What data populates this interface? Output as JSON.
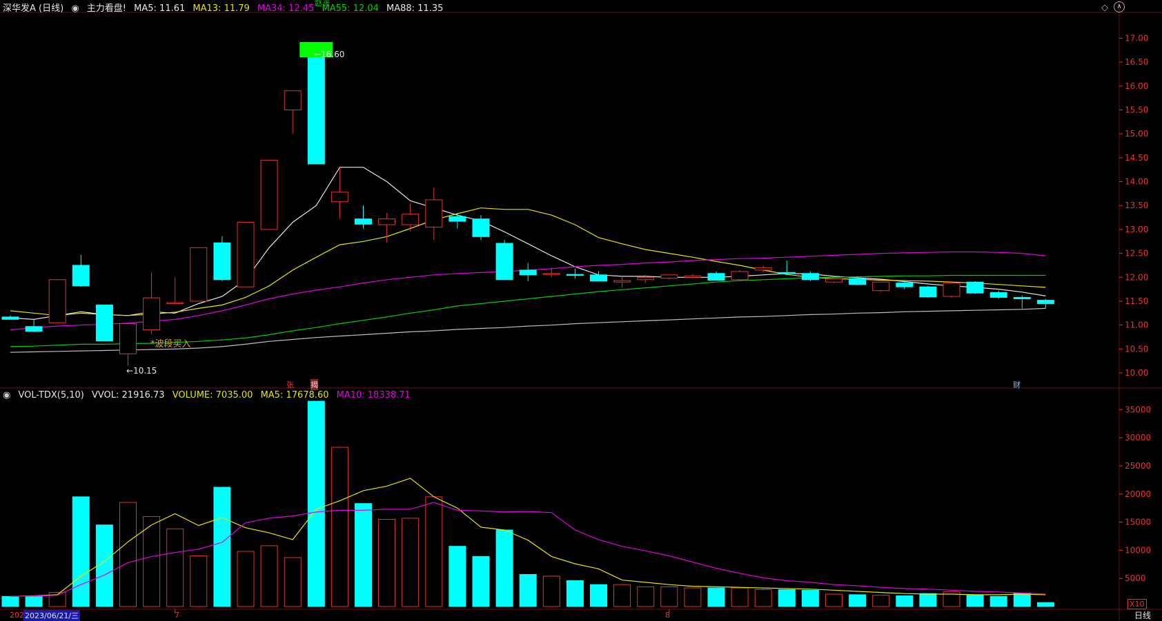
{
  "colors": {
    "up": "#e8322f",
    "down": "#00ffff",
    "ma5": "#e6e6e6",
    "ma13": "#e6e600",
    "ma34": "#e600e6",
    "ma55": "#00d200",
    "ma88": "#bfbfbf",
    "grid": "#7a0d0d",
    "axis": "#e8322f",
    "vol_ma5": "#e6e600",
    "vol_ma10": "#e600e6"
  },
  "header": {
    "title": "深华发A (日线)",
    "indicator_name": "主力看盘!",
    "ma5": "MA5: 11.61",
    "ma13": "MA13: 11.79",
    "ma34": "MA34: 12.45",
    "ma55": "MA55: 12.04",
    "ma88": "MA88: 11.35"
  },
  "vol_header": {
    "name": "VOL-TDX(5,10)",
    "vvol": "VVOL: 21916.73",
    "volume": "VOLUME: 7035.00",
    "ma5": "MA5: 17678.60",
    "ma10": "MA10: 18338.71"
  },
  "annotations": {
    "high_label": "16.60",
    "low_label": "10.15",
    "buy_signal": "*波段买入",
    "top_tag": "赵涨",
    "tag_zhang": "张",
    "tag_jie": "揭",
    "tag_cai": "财",
    "multiplier": "X10",
    "period": "日线"
  },
  "date_axis": {
    "year_fragment": "202",
    "cursor_date": "2023/06/21/三",
    "month_7": "7",
    "month_8": "8"
  },
  "chart_data": [
    {
      "type": "candlestick",
      "title": "深华发A (日线)",
      "ylim": [
        9.9,
        17.15
      ],
      "y_ticks": [
        "17.00",
        "16.50",
        "16.00",
        "15.50",
        "15.00",
        "14.50",
        "14.00",
        "13.50",
        "13.00",
        "12.50",
        "12.00",
        "11.50",
        "11.00",
        "10.50",
        "10.00"
      ],
      "candles": [
        {
          "o": 11.17,
          "h": 11.2,
          "l": 11.12,
          "c": 11.12
        },
        {
          "o": 10.97,
          "h": 11.11,
          "l": 10.85,
          "c": 10.87
        },
        {
          "o": 11.05,
          "h": 11.95,
          "l": 11.03,
          "c": 11.95
        },
        {
          "o": 12.25,
          "h": 12.47,
          "l": 11.8,
          "c": 11.82
        },
        {
          "o": 11.42,
          "h": 11.42,
          "l": 10.67,
          "c": 10.67
        },
        {
          "o": 10.4,
          "h": 11.03,
          "l": 10.15,
          "c": 11.03
        },
        {
          "o": 10.9,
          "h": 12.1,
          "l": 10.8,
          "c": 11.57
        },
        {
          "o": 11.47,
          "h": 12.0,
          "l": 11.47,
          "c": 11.47
        },
        {
          "o": 11.5,
          "h": 12.62,
          "l": 11.5,
          "c": 12.62
        },
        {
          "o": 12.72,
          "h": 12.86,
          "l": 11.92,
          "c": 11.95
        },
        {
          "o": 11.8,
          "h": 13.15,
          "l": 11.8,
          "c": 13.15
        },
        {
          "o": 13.0,
          "h": 14.45,
          "l": 13.0,
          "c": 14.45
        },
        {
          "o": 15.5,
          "h": 15.9,
          "l": 15.0,
          "c": 15.9
        },
        {
          "o": 16.6,
          "h": 16.92,
          "l": 14.37,
          "c": 14.37
        },
        {
          "o": 13.58,
          "h": 14.3,
          "l": 13.23,
          "c": 13.78
        },
        {
          "o": 13.22,
          "h": 13.5,
          "l": 13.02,
          "c": 13.11
        },
        {
          "o": 13.1,
          "h": 13.35,
          "l": 12.73,
          "c": 13.22
        },
        {
          "o": 13.1,
          "h": 13.55,
          "l": 12.95,
          "c": 13.32
        },
        {
          "o": 13.05,
          "h": 13.88,
          "l": 12.78,
          "c": 13.62
        },
        {
          "o": 13.27,
          "h": 13.35,
          "l": 13.02,
          "c": 13.17
        },
        {
          "o": 13.22,
          "h": 13.3,
          "l": 12.78,
          "c": 12.85
        },
        {
          "o": 12.71,
          "h": 12.78,
          "l": 11.95,
          "c": 11.95
        },
        {
          "o": 12.15,
          "h": 12.3,
          "l": 11.92,
          "c": 12.05
        },
        {
          "o": 12.06,
          "h": 12.2,
          "l": 12.0,
          "c": 12.08
        },
        {
          "o": 12.06,
          "h": 12.18,
          "l": 11.97,
          "c": 12.04
        },
        {
          "o": 12.05,
          "h": 12.13,
          "l": 11.92,
          "c": 11.92
        },
        {
          "o": 11.9,
          "h": 12.0,
          "l": 11.78,
          "c": 11.93
        },
        {
          "o": 11.95,
          "h": 12.05,
          "l": 11.88,
          "c": 12.0
        },
        {
          "o": 11.98,
          "h": 12.05,
          "l": 11.95,
          "c": 12.05
        },
        {
          "o": 12.0,
          "h": 12.07,
          "l": 11.98,
          "c": 12.03
        },
        {
          "o": 12.08,
          "h": 12.12,
          "l": 11.93,
          "c": 11.94
        },
        {
          "o": 11.95,
          "h": 12.15,
          "l": 11.93,
          "c": 12.12
        },
        {
          "o": 12.15,
          "h": 12.25,
          "l": 12.1,
          "c": 12.2
        },
        {
          "o": 12.1,
          "h": 12.35,
          "l": 12.05,
          "c": 12.08
        },
        {
          "o": 12.08,
          "h": 12.12,
          "l": 11.92,
          "c": 11.95
        },
        {
          "o": 11.9,
          "h": 11.98,
          "l": 11.88,
          "c": 11.97
        },
        {
          "o": 11.97,
          "h": 12.02,
          "l": 11.83,
          "c": 11.85
        },
        {
          "o": 11.72,
          "h": 11.9,
          "l": 11.7,
          "c": 11.9
        },
        {
          "o": 11.88,
          "h": 11.92,
          "l": 11.75,
          "c": 11.8
        },
        {
          "o": 11.8,
          "h": 11.82,
          "l": 11.57,
          "c": 11.59
        },
        {
          "o": 11.6,
          "h": 11.92,
          "l": 11.57,
          "c": 11.88
        },
        {
          "o": 11.9,
          "h": 11.92,
          "l": 11.65,
          "c": 11.67
        },
        {
          "o": 11.68,
          "h": 11.72,
          "l": 11.55,
          "c": 11.58
        },
        {
          "o": 11.58,
          "h": 11.62,
          "l": 11.35,
          "c": 11.55
        },
        {
          "o": 11.52,
          "h": 11.55,
          "l": 11.35,
          "c": 11.45
        }
      ],
      "ma_lines": [
        {
          "name": "MA5",
          "values": [
            11.15,
            11.12,
            11.2,
            11.28,
            11.22,
            11.2,
            11.28,
            11.25,
            11.45,
            11.6,
            11.95,
            12.62,
            13.15,
            13.5,
            14.3,
            14.3,
            14.0,
            13.6,
            13.45,
            13.3,
            13.18,
            12.95,
            12.7,
            12.45,
            12.22,
            12.05,
            12.02,
            12.02,
            12.0,
            12.0,
            12.0,
            12.02,
            12.05,
            12.08,
            12.07,
            12.02,
            11.99,
            11.96,
            11.91,
            11.86,
            11.82,
            11.79,
            11.75,
            11.69,
            11.61
          ]
        },
        {
          "name": "MA13",
          "values": [
            11.3,
            11.25,
            11.2,
            11.25,
            11.22,
            11.2,
            11.23,
            11.27,
            11.35,
            11.42,
            11.58,
            11.82,
            12.15,
            12.42,
            12.68,
            12.75,
            12.85,
            13.02,
            13.2,
            13.33,
            13.45,
            13.42,
            13.42,
            13.3,
            13.1,
            12.83,
            12.7,
            12.58,
            12.5,
            12.42,
            12.33,
            12.25,
            12.15,
            12.06,
            12.0,
            11.97,
            11.96,
            11.94,
            11.93,
            11.92,
            11.9,
            11.88,
            11.85,
            11.82,
            11.79
          ]
        },
        {
          "name": "MA34",
          "values": [
            10.9,
            10.95,
            10.98,
            11.0,
            11.02,
            11.04,
            11.08,
            11.12,
            11.2,
            11.3,
            11.42,
            11.55,
            11.65,
            11.73,
            11.8,
            11.88,
            11.95,
            12.0,
            12.05,
            12.08,
            12.1,
            12.12,
            12.15,
            12.18,
            12.22,
            12.25,
            12.27,
            12.3,
            12.32,
            12.35,
            12.37,
            12.39,
            12.4,
            12.42,
            12.44,
            12.46,
            12.48,
            12.5,
            12.51,
            12.52,
            12.53,
            12.53,
            12.52,
            12.5,
            12.45
          ]
        },
        {
          "name": "MA55",
          "values": [
            10.55,
            10.56,
            10.58,
            10.6,
            10.6,
            10.61,
            10.62,
            10.64,
            10.66,
            10.69,
            10.73,
            10.8,
            10.88,
            10.95,
            11.03,
            11.1,
            11.17,
            11.25,
            11.32,
            11.4,
            11.45,
            11.5,
            11.55,
            11.6,
            11.65,
            11.7,
            11.74,
            11.78,
            11.82,
            11.86,
            11.9,
            11.93,
            11.95,
            11.97,
            11.99,
            12.0,
            12.01,
            12.02,
            12.03,
            12.03,
            12.04,
            12.04,
            12.04,
            12.04,
            12.04
          ]
        },
        {
          "name": "MA88",
          "values": [
            10.43,
            10.44,
            10.45,
            10.46,
            10.47,
            10.48,
            10.49,
            10.5,
            10.52,
            10.55,
            10.6,
            10.66,
            10.7,
            10.74,
            10.77,
            10.8,
            10.83,
            10.86,
            10.88,
            10.91,
            10.93,
            10.95,
            10.98,
            11.0,
            11.03,
            11.05,
            11.07,
            11.09,
            11.11,
            11.13,
            11.15,
            11.17,
            11.18,
            11.2,
            11.22,
            11.23,
            11.25,
            11.26,
            11.28,
            11.29,
            11.3,
            11.31,
            11.32,
            11.33,
            11.35
          ]
        }
      ]
    },
    {
      "type": "bar",
      "title": "VOL-TDX(5,10)",
      "ylim": [
        0,
        37000
      ],
      "y_ticks": [
        "35000",
        "30000",
        "25000",
        "20000",
        "15000",
        "10000",
        "5000"
      ],
      "volumes": [
        1800,
        1800,
        2500,
        19500,
        14500,
        18500,
        16000,
        13800,
        9000,
        21200,
        9800,
        10800,
        8700,
        36500,
        28300,
        18300,
        15500,
        15700,
        19500,
        10700,
        8900,
        13600,
        5700,
        5400,
        4600,
        3900,
        3900,
        3500,
        3500,
        3300,
        3300,
        3300,
        3000,
        3000,
        2900,
        2200,
        2100,
        2000,
        1900,
        2300,
        2600,
        2000,
        1800,
        2400,
        700
      ],
      "ma5": [
        1800,
        1900,
        2100,
        5400,
        8000,
        11500,
        14500,
        16500,
        14400,
        15800,
        14000,
        13100,
        11900,
        17300,
        18800,
        20600,
        21400,
        22800,
        19500,
        17500,
        14100,
        13600,
        11800,
        8900,
        7600,
        6700,
        4700,
        4300,
        3900,
        3600,
        3500,
        3400,
        3300,
        3200,
        3100,
        2900,
        2700,
        2500,
        2300,
        2200,
        2200,
        2100,
        2100,
        2200,
        2100
      ],
      "ma10": [
        1800,
        1850,
        2000,
        3900,
        5600,
        7800,
        8900,
        9600,
        10200,
        11400,
        14900,
        15700,
        16100,
        16800,
        17100,
        17100,
        17300,
        17300,
        18500,
        17100,
        17000,
        16800,
        16900,
        16700,
        13600,
        11900,
        10700,
        9900,
        9000,
        7900,
        6800,
        5900,
        5100,
        4600,
        4300,
        3900,
        3700,
        3400,
        3200,
        3100,
        2900,
        2700,
        2600,
        2400,
        2200
      ]
    }
  ]
}
